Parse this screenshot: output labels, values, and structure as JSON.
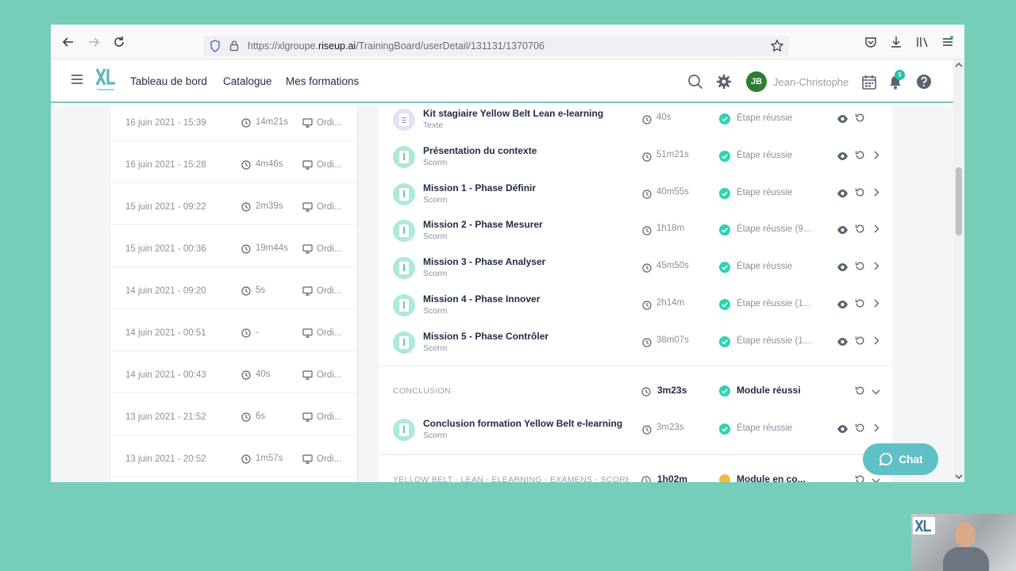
{
  "browser": {
    "url_prefix": "https://xlgroupe.",
    "url_domain": "riseup.ai",
    "url_path": "/TrainingBoard/userDetail/131131/1370706"
  },
  "header": {
    "nav": [
      "Tableau de bord",
      "Catalogue",
      "Mes formations"
    ],
    "avatar_initials": "JB",
    "user_name": "Jean-Christophe",
    "notification_count": "9"
  },
  "sessions": [
    {
      "date": "16 juin 2021 - 15:39",
      "duration": "14m21s",
      "device": "Ordi..."
    },
    {
      "date": "16 juin 2021 - 15:28",
      "duration": "4m46s",
      "device": "Ordi..."
    },
    {
      "date": "15 juin 2021 - 09:22",
      "duration": "2m39s",
      "device": "Ordi..."
    },
    {
      "date": "15 juin 2021 - 00:36",
      "duration": "19m44s",
      "device": "Ordi..."
    },
    {
      "date": "14 juin 2021 - 09:20",
      "duration": "5s",
      "device": "Ordi..."
    },
    {
      "date": "14 juin 2021 - 00:51",
      "duration": "-",
      "device": "Ordi..."
    },
    {
      "date": "14 juin 2021 - 00:43",
      "duration": "40s",
      "device": "Ordi..."
    },
    {
      "date": "13 juin 2021 - 21:52",
      "duration": "6s",
      "device": "Ordi..."
    },
    {
      "date": "13 juin 2021 - 20:52",
      "duration": "1m57s",
      "device": "Ordi..."
    }
  ],
  "modules": [
    {
      "title": "Kit stagiaire Yellow Belt Lean e-learning",
      "type": "Texte",
      "duration": "40s",
      "status": "Étape réussie"
    },
    {
      "title": "Présentation du contexte",
      "type": "Scorm",
      "duration": "51m21s",
      "status": "Étape réussie"
    },
    {
      "title": "Mission 1 - Phase Définir",
      "type": "Scorm",
      "duration": "40m55s",
      "status": "Étape réussie"
    },
    {
      "title": "Mission 2 - Phase Mesurer",
      "type": "Scorm",
      "duration": "1h18m",
      "status": "Étape réussie (9..."
    },
    {
      "title": "Mission 3 - Phase Analyser",
      "type": "Scorm",
      "duration": "45m50s",
      "status": "Étape réussie"
    },
    {
      "title": "Mission 4 - Phase Innover",
      "type": "Scorm",
      "duration": "2h14m",
      "status": "Étape réussie (1..."
    },
    {
      "title": "Mission 5 - Phase Contrôler",
      "type": "Scorm",
      "duration": "38m07s",
      "status": "Étape réussie (1..."
    }
  ],
  "sections": [
    {
      "name": "CONCLUSION",
      "duration": "3m23s",
      "status": "Module réussi",
      "status_color": "#2dd4b0"
    },
    {
      "name": "YELLOW BELT - LEAN - ELEARNING - EXAMENS - SCORE CI",
      "duration": "1h02m",
      "status": "Module en co...",
      "status_color": "#f5b942"
    }
  ],
  "conclusion_item": {
    "title": "Conclusion formation Yellow Belt e-learning",
    "type": "Scorm",
    "duration": "3m23s",
    "status": "Étape réussie"
  },
  "chat_label": "Chat",
  "colors": {
    "accent": "#5fc1c6",
    "success": "#2dd4b0",
    "warning": "#f5b942",
    "page_bg": "#76cdb9"
  }
}
